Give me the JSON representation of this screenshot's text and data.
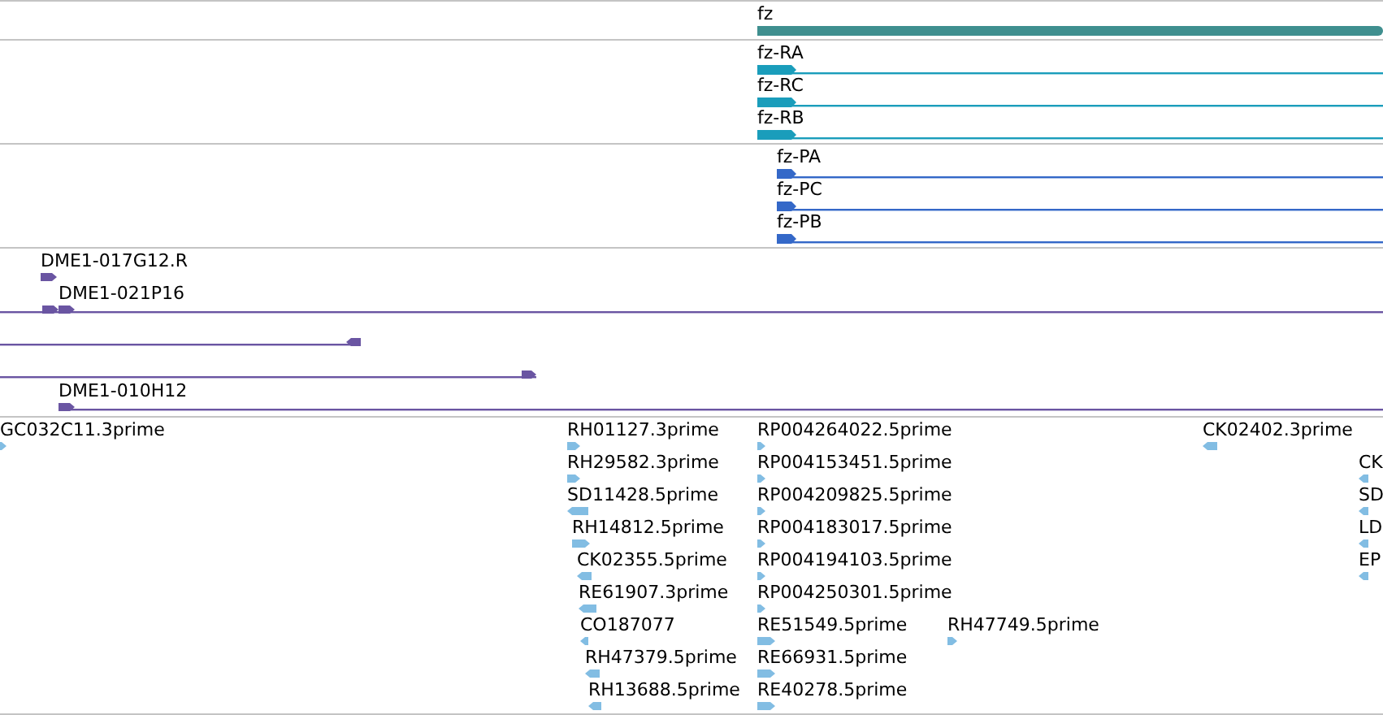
{
  "tracks": [
    {
      "kind": "gene",
      "features": [
        {
          "label": "fz",
          "reverse": false
        }
      ]
    },
    {
      "kind": "transcript",
      "features": [
        {
          "label": "fz-RA",
          "reverse": false
        },
        {
          "label": "fz-RC",
          "reverse": false
        },
        {
          "label": "fz-RB",
          "reverse": false
        }
      ]
    },
    {
      "kind": "protein",
      "features": [
        {
          "label": "fz-PA",
          "reverse": false
        },
        {
          "label": "fz-PC",
          "reverse": false
        },
        {
          "label": "fz-PB",
          "reverse": false
        }
      ]
    },
    {
      "kind": "clone",
      "features": [
        {
          "label": "DME1-017G12.R",
          "reverse": false
        },
        {
          "label": "DME1-021P16",
          "reverse": false
        },
        {
          "reverse": true
        },
        {
          "reverse": false
        },
        {
          "label": "DME1-010H12",
          "reverse": false
        }
      ]
    },
    {
      "kind": "est",
      "features": [
        {
          "label": "GC032C11.3prime",
          "reverse": false
        },
        {
          "label": "RH01127.3prime",
          "reverse": false
        },
        {
          "label": "RH29582.3prime",
          "reverse": false
        },
        {
          "label": "SD11428.5prime",
          "reverse": true
        },
        {
          "label": "RH14812.5prime",
          "reverse": false
        },
        {
          "label": "CK02355.5prime",
          "reverse": true
        },
        {
          "label": "RE61907.3prime",
          "reverse": true
        },
        {
          "label": "CO187077",
          "reverse": true
        },
        {
          "label": "RH47379.5prime",
          "reverse": true
        },
        {
          "label": "RH13688.5prime",
          "reverse": true
        },
        {
          "label": "RP004264022.5prime",
          "reverse": false
        },
        {
          "label": "RP004153451.5prime",
          "reverse": false
        },
        {
          "label": "RP004209825.5prime",
          "reverse": false
        },
        {
          "label": "RP004183017.5prime",
          "reverse": false
        },
        {
          "label": "RP004194103.5prime",
          "reverse": false
        },
        {
          "label": "RP004250301.5prime",
          "reverse": false
        },
        {
          "label": "RE51549.5prime",
          "reverse": false
        },
        {
          "label": "RE66931.5prime",
          "reverse": false
        },
        {
          "label": "RE40278.5prime",
          "reverse": false
        },
        {
          "label": "RH47749.5prime",
          "reverse": false
        },
        {
          "label": "CK02402.3prime",
          "reverse": true
        },
        {
          "label": "CK",
          "reverse": true
        },
        {
          "label": "SD",
          "reverse": true
        },
        {
          "label": "LD",
          "reverse": true
        },
        {
          "label": "EP",
          "reverse": true
        }
      ]
    }
  ]
}
